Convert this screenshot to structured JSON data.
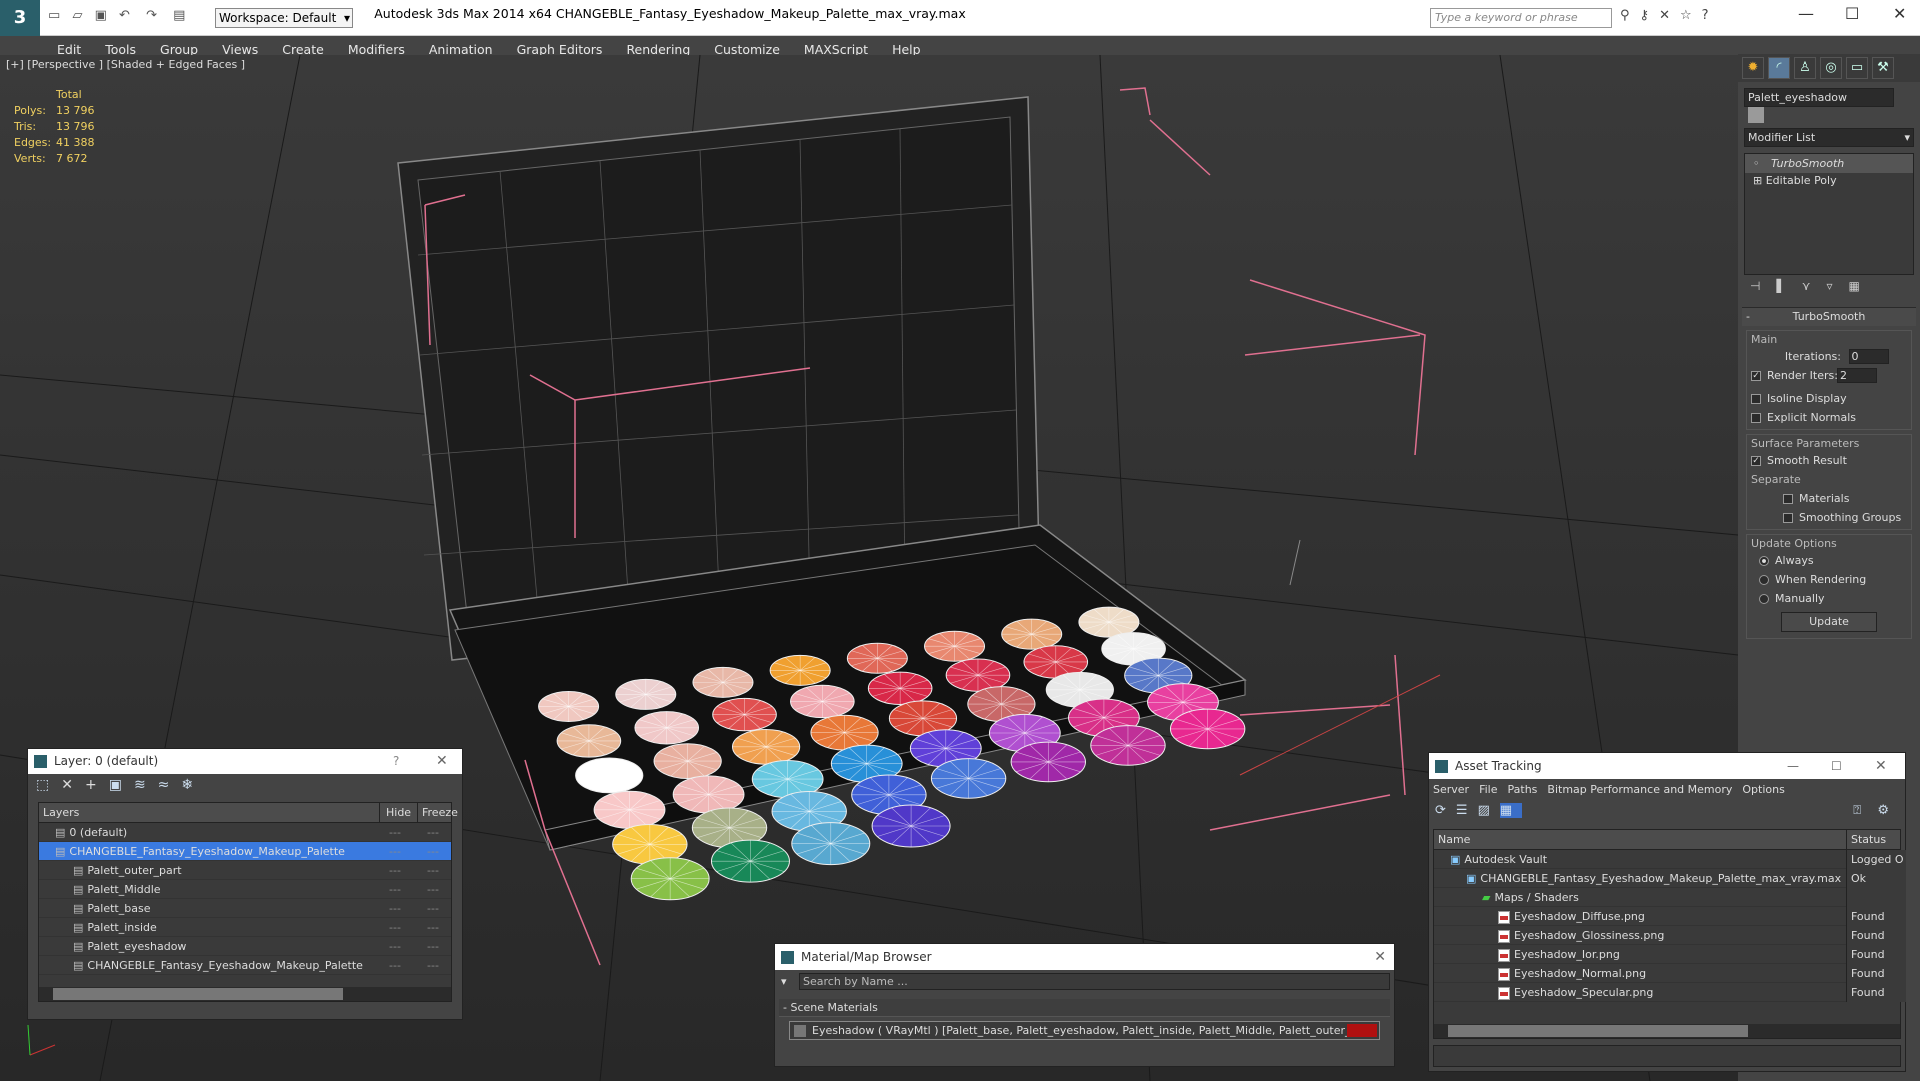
{
  "window": {
    "title": "Autodesk 3ds Max  2014 x64      CHANGEBLE_Fantasy_Eyeshadow_Makeup_Palette_max_vray.max",
    "workspace": "Workspace: Default",
    "search_placeholder": "Type a keyword or phrase"
  },
  "menu": [
    "Edit",
    "Tools",
    "Group",
    "Views",
    "Create",
    "Modifiers",
    "Animation",
    "Graph Editors",
    "Rendering",
    "Customize",
    "MAXScript",
    "Help"
  ],
  "viewport": {
    "label": "[+] [Perspective ] [Shaded + Edged Faces ]",
    "stats": {
      "header": "Total",
      "rows": [
        {
          "label": "Polys:",
          "value": "13 796"
        },
        {
          "label": "Tris:",
          "value": "13 796"
        },
        {
          "label": "Edges:",
          "value": "41 388"
        },
        {
          "label": "Verts:",
          "value": "7 672"
        }
      ]
    }
  },
  "command_panel": {
    "object_name": "Palett_eyeshadow",
    "modifier_list": "Modifier List",
    "stack": [
      "TurboSmooth",
      "Editable Poly"
    ],
    "rollout_title": "TurboSmooth",
    "main_group": "Main",
    "iterations_label": "Iterations:",
    "iterations_value": "0",
    "render_iters_label": "Render Iters:",
    "render_iters_value": "2",
    "isoline": "Isoline Display",
    "explicit_normals": "Explicit Normals",
    "surface_group": "Surface Parameters",
    "smooth_result": "Smooth Result",
    "separate": "Separate",
    "materials": "Materials",
    "smoothing_groups": "Smoothing Groups",
    "update_group": "Update Options",
    "always": "Always",
    "when_rendering": "When Rendering",
    "manually": "Manually",
    "update_button": "Update"
  },
  "layer_window": {
    "title": "Layer: 0 (default)",
    "help": "?",
    "col_layers": "Layers",
    "col_hide": "Hide",
    "col_freeze": "Freeze",
    "rows": [
      {
        "name": "0 (default)",
        "indent": 1
      },
      {
        "name": "CHANGEBLE_Fantasy_Eyeshadow_Makeup_Palette",
        "indent": 1,
        "selected": true
      },
      {
        "name": "Palett_outer_part",
        "indent": 2
      },
      {
        "name": "Palett_Middle",
        "indent": 2
      },
      {
        "name": "Palett_base",
        "indent": 2
      },
      {
        "name": "Palett_inside",
        "indent": 2
      },
      {
        "name": "Palett_eyeshadow",
        "indent": 2
      },
      {
        "name": "CHANGEBLE_Fantasy_Eyeshadow_Makeup_Palette",
        "indent": 2
      }
    ]
  },
  "material_browser": {
    "title": "Material/Map Browser",
    "search_placeholder": "Search by Name ...",
    "section": "- Scene Materials",
    "item": "Eyeshadow  ( VRayMtl ) [Palett_base, Palett_eyeshadow, Palett_inside, Palett_Middle, Palett_outer_part]",
    "swatch_color": "#b01010"
  },
  "asset_tracking": {
    "title": "Asset Tracking",
    "menu": [
      "Server",
      "File",
      "Paths",
      "Bitmap Performance and Memory",
      "Options"
    ],
    "col_name": "Name",
    "col_status": "Status",
    "rows": [
      {
        "name": "Autodesk Vault",
        "status": "Logged O",
        "indent": 1
      },
      {
        "name": "CHANGEBLE_Fantasy_Eyeshadow_Makeup_Palette_max_vray.max",
        "status": "Ok",
        "indent": 2
      },
      {
        "name": "Maps / Shaders",
        "status": "",
        "indent": 3
      },
      {
        "name": "Eyeshadow_Diffuse.png",
        "status": "Found",
        "indent": 4
      },
      {
        "name": "Eyeshadow_Glossiness.png",
        "status": "Found",
        "indent": 4
      },
      {
        "name": "Eyeshadow_Ior.png",
        "status": "Found",
        "indent": 4
      },
      {
        "name": "Eyeshadow_Normal.png",
        "status": "Found",
        "indent": 4
      },
      {
        "name": "Eyeshadow_Specular.png",
        "status": "Found",
        "indent": 4
      }
    ]
  },
  "palette_colors": [
    [
      "#f0c8c0",
      "#ecd0d0",
      "#e8b8a8",
      "#f0a030",
      "#e06858",
      "#e88870",
      "#e8a878",
      "#eedcc8"
    ],
    [
      "#e8b898",
      "#f0c8c8",
      "#e05050",
      "#f0a8b0",
      "#d82848",
      "#d83050",
      "#d83848",
      "#f0f0f0"
    ],
    [
      "#ffffff",
      "#e8b0a0",
      "#f0a050",
      "#e87838",
      "#d84838",
      "#c86868",
      "#e8e8e8",
      "#5878c8"
    ],
    [
      "#f8c8c8",
      "#f0b8b8",
      "#68c8e0",
      "#2890d8",
      "#6040d8",
      "#b050d0",
      "#d83088",
      "#e840a0"
    ],
    [
      "#f8c840",
      "#a8b088",
      "#68b8e0",
      "#4060d8",
      "#4878d8",
      "#a028a8",
      "#c03098",
      "#e82890"
    ],
    [
      "#88c048",
      "#188858",
      "#58a8d0",
      "#5038c8",
      "#0",
      "#0",
      "#0",
      "#0"
    ]
  ]
}
